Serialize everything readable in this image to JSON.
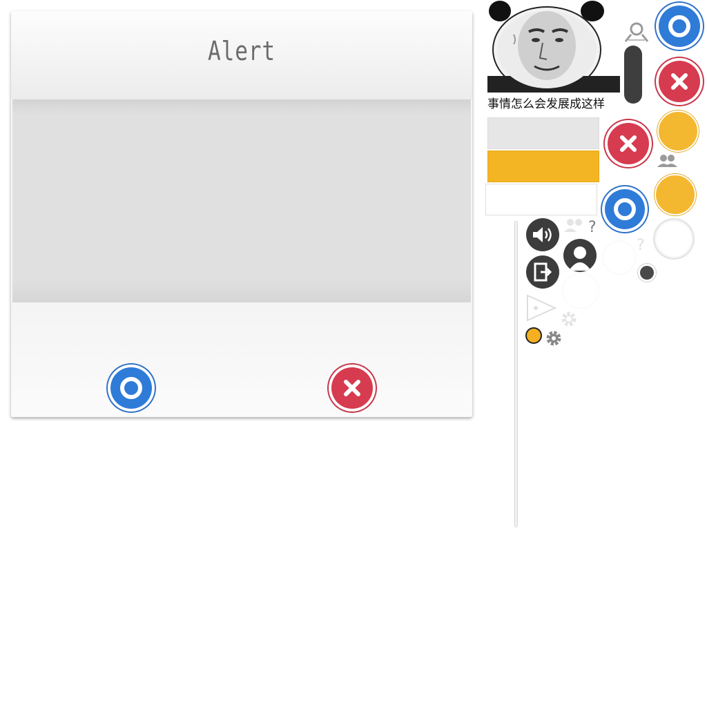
{
  "alert": {
    "title": "Alert"
  },
  "meme": {
    "caption": "事情怎么会发展成这样"
  },
  "colors": {
    "primary_blue": "#2f7bd8",
    "danger_red": "#d63b4f",
    "warning_yellow": "#f4b830",
    "dark_gray": "#3c3c3c"
  },
  "icons": [
    "confirm-circle-icon",
    "cancel-x-icon",
    "sound-icon",
    "exit-icon",
    "user-icon",
    "play-icon",
    "settings-gear-icon",
    "friends-icon",
    "unknown-user-icon",
    "face-link-icon"
  ]
}
